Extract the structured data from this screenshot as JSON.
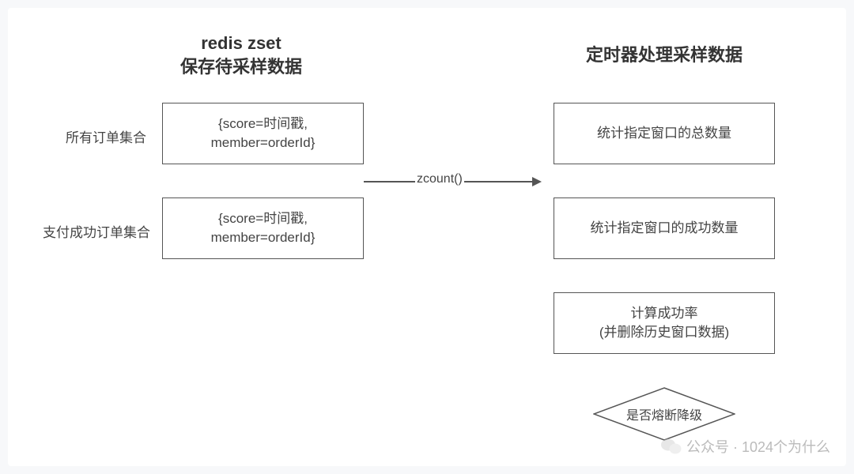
{
  "headings": {
    "left_line1": "redis zset",
    "left_line2": "保存待采样数据",
    "right": "定时器处理采样数据"
  },
  "leftLabels": {
    "allOrders": "所有订单集合",
    "paidOrders": "支付成功订单集合"
  },
  "leftBoxes": {
    "box1_line1": "{score=时间戳,",
    "box1_line2": "member=orderId}",
    "box2_line1": "{score=时间戳,",
    "box2_line2": "member=orderId}"
  },
  "arrow": {
    "label": "zcount()"
  },
  "rightBoxes": {
    "r1": "统计指定窗口的总数量",
    "r2": "统计指定窗口的成功数量",
    "r3_line1": "计算成功率",
    "r3_line2": "(并删除历史窗口数据)"
  },
  "decision": {
    "text": "是否熔断降级"
  },
  "watermark": {
    "text": "公众号 · 1024个为什么"
  }
}
